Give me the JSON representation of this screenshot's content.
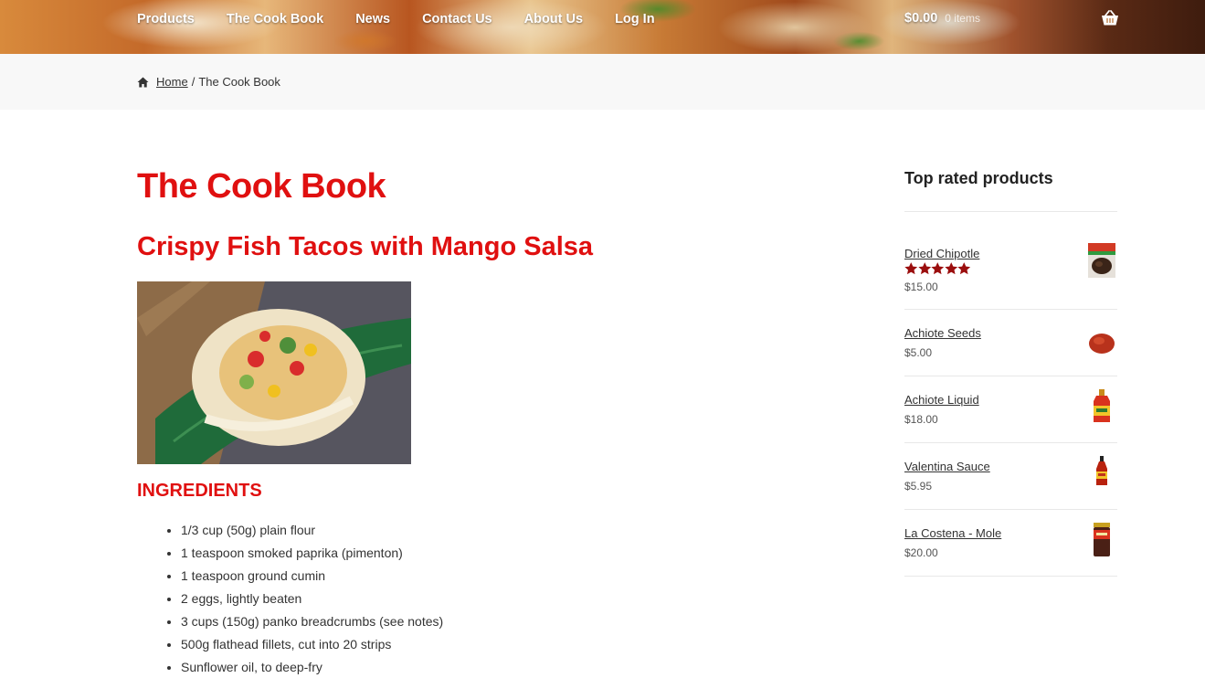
{
  "nav": {
    "items": [
      "Products",
      "The Cook Book",
      "News",
      "Contact Us",
      "About Us",
      "Log In"
    ]
  },
  "cart": {
    "amount": "$0.00",
    "count": "0 items"
  },
  "breadcrumb": {
    "home": "Home",
    "separator": "/",
    "current": "The Cook Book"
  },
  "page": {
    "title": "The Cook Book",
    "recipe_title": "Crispy Fish Tacos with Mango Salsa",
    "ingredients_heading": "INGREDIENTS",
    "ingredients": [
      "1/3 cup (50g) plain flour",
      "1 teaspoon smoked paprika (pimenton)",
      "1 teaspoon ground cumin",
      "2 eggs, lightly beaten",
      "3 cups (150g) panko breadcrumbs (see notes)",
      "500g flathead fillets, cut into 20 strips",
      "Sunflower oil, to deep-fry"
    ]
  },
  "sidebar": {
    "title": "Top rated products",
    "products": [
      {
        "name": "Dried Chipotle",
        "price": "$15.00",
        "rating": 5
      },
      {
        "name": "Achiote Seeds",
        "price": "$5.00"
      },
      {
        "name": "Achiote Liquid",
        "price": "$18.00"
      },
      {
        "name": "Valentina Sauce",
        "price": "$5.95"
      },
      {
        "name": "La Costena - Mole",
        "price": "$20.00"
      }
    ]
  },
  "colors": {
    "accent": "#e01010",
    "star": "#9b0e0e",
    "breadcrumb_bg": "#f8f8f8"
  },
  "icons": {
    "home": "home-icon",
    "cart": "basket-icon",
    "star": "star-icon"
  }
}
